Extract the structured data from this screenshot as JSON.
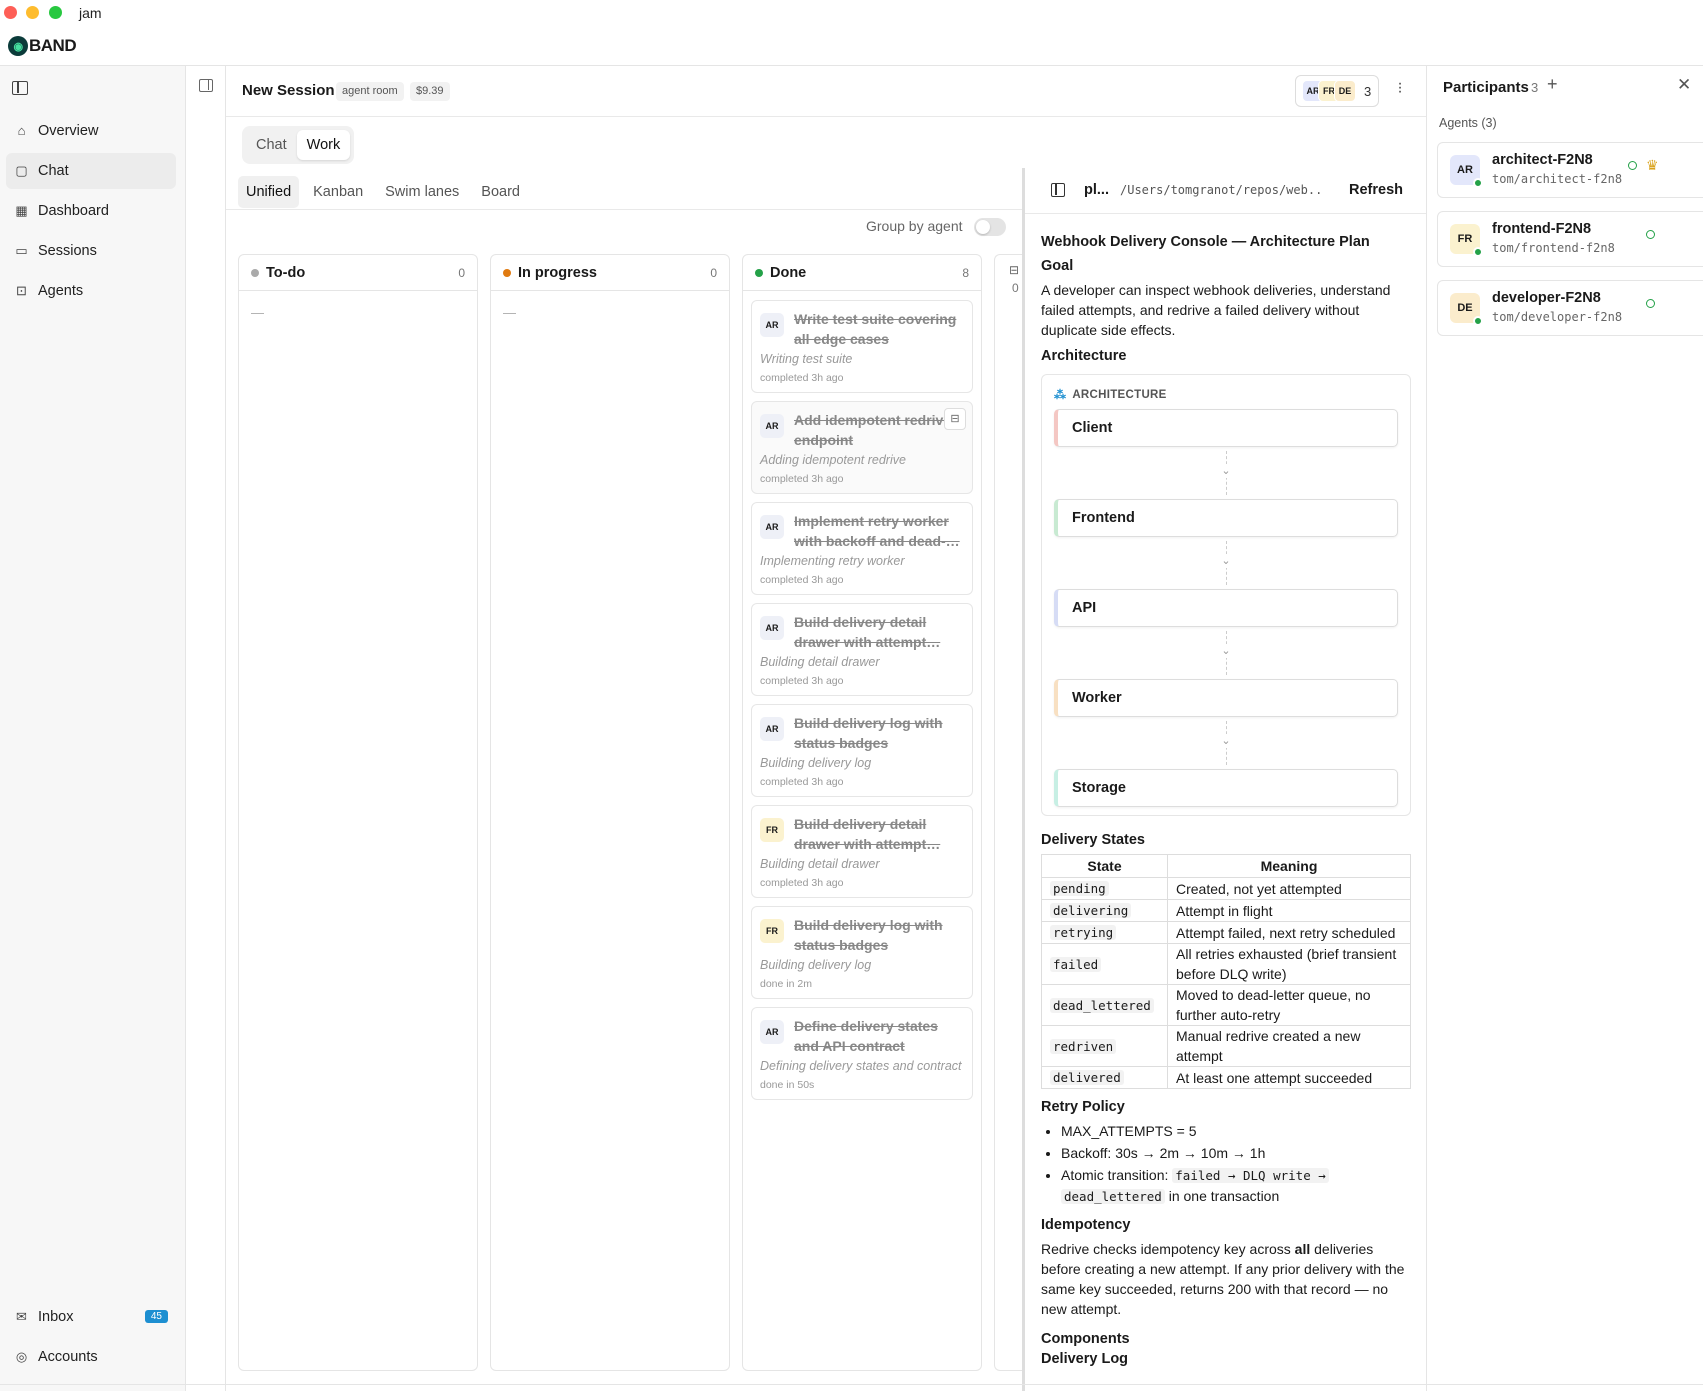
{
  "window": {
    "title": "jam",
    "colors": {
      "close": "#fe5f57",
      "minimize": "#febc2e",
      "maximize": "#28c840"
    }
  },
  "brand": {
    "logo_text": "BAND"
  },
  "sidebar": {
    "items": [
      {
        "label": "Overview",
        "icon": "home-icon"
      },
      {
        "label": "Chat",
        "icon": "chat-icon",
        "active": true
      },
      {
        "label": "Dashboard",
        "icon": "grid-icon"
      },
      {
        "label": "Sessions",
        "icon": "monitor-icon"
      },
      {
        "label": "Agents",
        "icon": "bot-icon"
      }
    ],
    "bottom": [
      {
        "label": "Inbox",
        "icon": "inbox-icon",
        "badge": "45"
      },
      {
        "label": "Accounts",
        "icon": "account-icon"
      }
    ]
  },
  "header": {
    "title": "New Session",
    "chip_room": "agent room",
    "chip_cost": "$9.39",
    "avatars": [
      "AR",
      "FR",
      "DE"
    ],
    "avatar_count": "3"
  },
  "mode_tabs": [
    "Chat",
    "Work"
  ],
  "view_tabs": [
    "Unified",
    "Kanban",
    "Swim lanes",
    "Board"
  ],
  "group_by_label": "Group by agent",
  "columns": {
    "todo": {
      "label": "To-do",
      "count": "0",
      "empty": "—",
      "color": "#aaaaaa"
    },
    "progress": {
      "label": "In progress",
      "count": "0",
      "empty": "—",
      "color": "#e07a10"
    },
    "done": {
      "label": "Done",
      "count": "8",
      "color": "#24a148"
    },
    "cut_count": "0"
  },
  "cards": [
    {
      "agent": "AR",
      "title": "Write test suite covering all edge cases",
      "sub": "Writing test suite",
      "time": "completed 3h ago"
    },
    {
      "agent": "AR",
      "title": "Add idempotent redrive endpoint",
      "sub": "Adding idempotent redrive",
      "time": "completed 3h ago"
    },
    {
      "agent": "AR",
      "title": "Implement retry worker with backoff and dead-…",
      "sub": "Implementing retry worker",
      "time": "completed 3h ago"
    },
    {
      "agent": "AR",
      "title": "Build delivery detail drawer with attempt…",
      "sub": "Building detail drawer",
      "time": "completed 3h ago"
    },
    {
      "agent": "AR",
      "title": "Build delivery log with status badges",
      "sub": "Building delivery log",
      "time": "completed 3h ago"
    },
    {
      "agent": "FR",
      "title": "Build delivery detail drawer with attempt…",
      "sub": "Building detail drawer",
      "time": "completed 3h ago"
    },
    {
      "agent": "FR",
      "title": "Build delivery log with status badges",
      "sub": "Building delivery log",
      "time": "done in 2m"
    },
    {
      "agent": "AR",
      "title": "Define delivery states and API contract",
      "sub": "Defining delivery states and contract",
      "time": "done in 50s"
    }
  ],
  "plan": {
    "name": "pl...",
    "path": "/Users/tomgranot/repos/web...",
    "refresh": "Refresh",
    "title": "Webhook Delivery Console — Architecture Plan",
    "goal_heading": "Goal",
    "goal_text": "A developer can inspect webhook deliveries, understand failed attempts, and redrive a failed delivery without duplicate side effects.",
    "arch_heading": "Architecture",
    "arch_label": "ARCHITECTURE",
    "nodes": [
      {
        "label": "Client",
        "color": "#f4c7c3"
      },
      {
        "label": "Frontend",
        "color": "#c8ead2"
      },
      {
        "label": "API",
        "color": "#d6dcf5"
      },
      {
        "label": "Worker",
        "color": "#f8e0c2"
      },
      {
        "label": "Storage",
        "color": "#c7efe4"
      }
    ],
    "states_heading": "Delivery States",
    "states_cols": [
      "State",
      "Meaning"
    ],
    "states": [
      [
        "pending",
        "Created, not yet attempted"
      ],
      [
        "delivering",
        "Attempt in flight"
      ],
      [
        "retrying",
        "Attempt failed, next retry scheduled"
      ],
      [
        "failed",
        "All retries exhausted (brief transient before DLQ write)"
      ],
      [
        "dead_lettered",
        "Moved to dead-letter queue, no further auto-retry"
      ],
      [
        "redriven",
        "Manual redrive created a new attempt"
      ],
      [
        "delivered",
        "At least one attempt succeeded"
      ]
    ],
    "retry_heading": "Retry Policy",
    "retry_1": "MAX_ATTEMPTS = 5",
    "retry_2": "Backoff: 30s → 2m → 10m → 1h",
    "retry_3_pre": "Atomic transition: ",
    "retry_3_code1": "failed → DLQ write →",
    "retry_3_code2": "dead_lettered",
    "retry_3_post": " in one transaction",
    "idem_heading": "Idempotency",
    "idem_pre": "Redrive checks idempotency key across ",
    "idem_bold": "all",
    "idem_post": " deliveries before creating a new attempt. If any prior delivery with the same key succeeded, returns 200 with that record — no new attempt.",
    "components_heading": "Components",
    "delivery_log_heading": "Delivery Log"
  },
  "participants": {
    "title": "Participants",
    "count": "3",
    "group": "Agents (3)",
    "agents": [
      {
        "initials": "AR",
        "name": "architect-F2N8",
        "handle": "tom/architect-f2n8",
        "color": "#e3e7fb"
      },
      {
        "initials": "FR",
        "name": "frontend-F2N8",
        "handle": "tom/frontend-f2n8",
        "color": "#fbf2cf"
      },
      {
        "initials": "DE",
        "name": "developer-F2N8",
        "handle": "tom/developer-f2n8",
        "color": "#fbeccc"
      }
    ]
  }
}
